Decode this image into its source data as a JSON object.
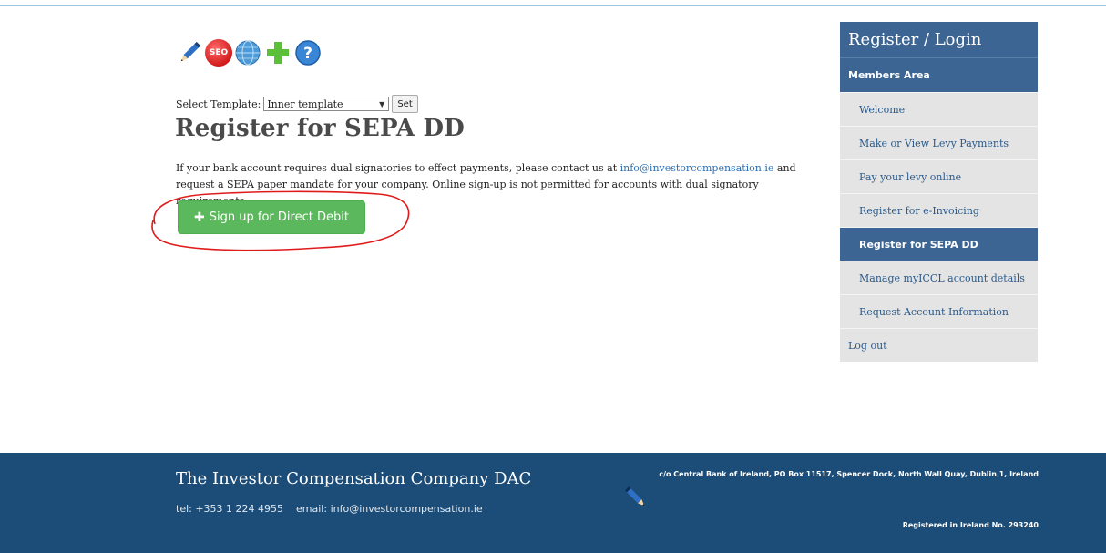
{
  "toolbar": {
    "icons": [
      "pencil-icon",
      "seo-icon",
      "globe-icon",
      "plus-icon",
      "help-icon"
    ],
    "seo_text": "SEO"
  },
  "template": {
    "label": "Select Template:",
    "value": "Inner template",
    "set_label": "Set"
  },
  "page": {
    "title": "Register for SEPA DD",
    "intro_1": "If your bank account requires dual signatories to effect payments, please contact us at ",
    "email": "info@investorcompensation.ie",
    "intro_2": " and request a SEPA paper mandate for your company.  Online sign-up ",
    "intro_emph": "is not",
    "intro_3": " permitted for accounts with dual signatory requirements.",
    "signup_label": "Sign up for Direct Debit",
    "signup_icon": "plus-icon"
  },
  "sidebar": {
    "header": "Register / Login",
    "section": "Members Area",
    "items": [
      {
        "label": "Welcome",
        "active": false
      },
      {
        "label": "Make or View Levy Payments",
        "active": false
      },
      {
        "label": "Pay your levy online",
        "active": false
      },
      {
        "label": "Register for e-Invoicing",
        "active": false
      },
      {
        "label": "Register for SEPA DD",
        "active": true
      },
      {
        "label": "Manage myICCL account details",
        "active": false
      },
      {
        "label": "Request Account Information",
        "active": false
      }
    ],
    "logout": "Log out"
  },
  "footer": {
    "company": "The Investor Compensation Company DAC",
    "tel": "tel: +353 1 224 4955",
    "email": "email: info@investorcompensation.ie",
    "address": "c/o Central Bank of Ireland, PO Box 11517, Spencer Dock, North Wall Quay, Dublin 1, Ireland",
    "registration": "Registered in Ireland No. 293240"
  },
  "colors": {
    "primary": "#3c6593",
    "footer_bg": "#1c4d78",
    "button_green": "#5cb85c",
    "annotation_red": "#e01b1b"
  }
}
